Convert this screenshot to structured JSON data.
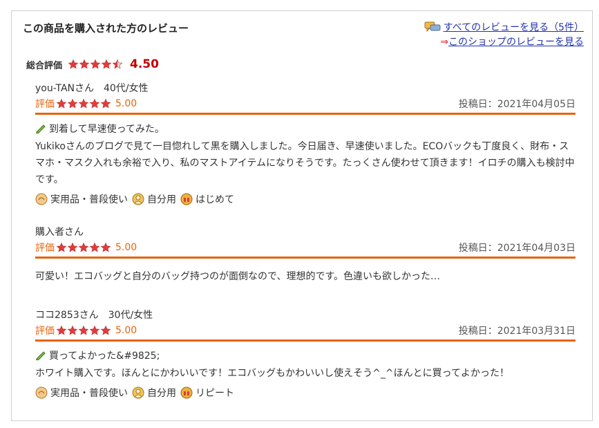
{
  "header": {
    "title": "この商品を購入された方のレビュー",
    "all_reviews_link": "すべてのレビューを見る（5件）",
    "shop_reviews_arrow": "⇒",
    "shop_reviews_link": "このショップのレビューを見る"
  },
  "overall": {
    "label": "総合評価",
    "score": "4.50",
    "stars": 4.5
  },
  "rating_label": "評価",
  "reviews": [
    {
      "reviewer": "you-TANさん　40代/女性",
      "stars": 5,
      "score": "5.00",
      "date": "投稿日：2021年04月05日",
      "title": "到着して早速使ってみた。",
      "body": "Yukikoさんのブログで見て一目惚れして黒を購入しました。今日届き、早速使いました。ECOバックも丁度良く、財布・スマホ・マスク入れも余裕で入り、私のマストアイテムになりそうです。たっくさん使わせて頂きます！イロチの購入も検討中です。",
      "tags": [
        "実用品・普段使い",
        "自分用",
        "はじめて"
      ]
    },
    {
      "reviewer": "購入者さん",
      "stars": 5,
      "score": "5.00",
      "date": "投稿日：2021年04月03日",
      "title": "",
      "body": "可愛い！エコバッグと自分のバッグ持つのが面倒なので、理想的です。色違いも欲しかった…",
      "tags": []
    },
    {
      "reviewer": "ココ2853さん　30代/女性",
      "stars": 5,
      "score": "5.00",
      "date": "投稿日：2021年03月31日",
      "title": "買ってよかった&#9825;",
      "body": "ホワイト購入です。ほんとにかわいいです！エコバッグもかわいいし使えそう^_^ほんとに買ってよかった！",
      "tags": [
        "実用品・普段使い",
        "自分用",
        "リピート"
      ]
    }
  ],
  "colors": {
    "accent": "#e8620a",
    "star": "#e23b3b",
    "score_red": "#bf0000",
    "link": "#2233aa"
  },
  "icons": {
    "chat": "speech-bubbles-icon",
    "pencil": "pencil-icon",
    "tag_usage": "hand-icon",
    "tag_self": "person-icon",
    "tag_purchase": "gift-icon"
  }
}
